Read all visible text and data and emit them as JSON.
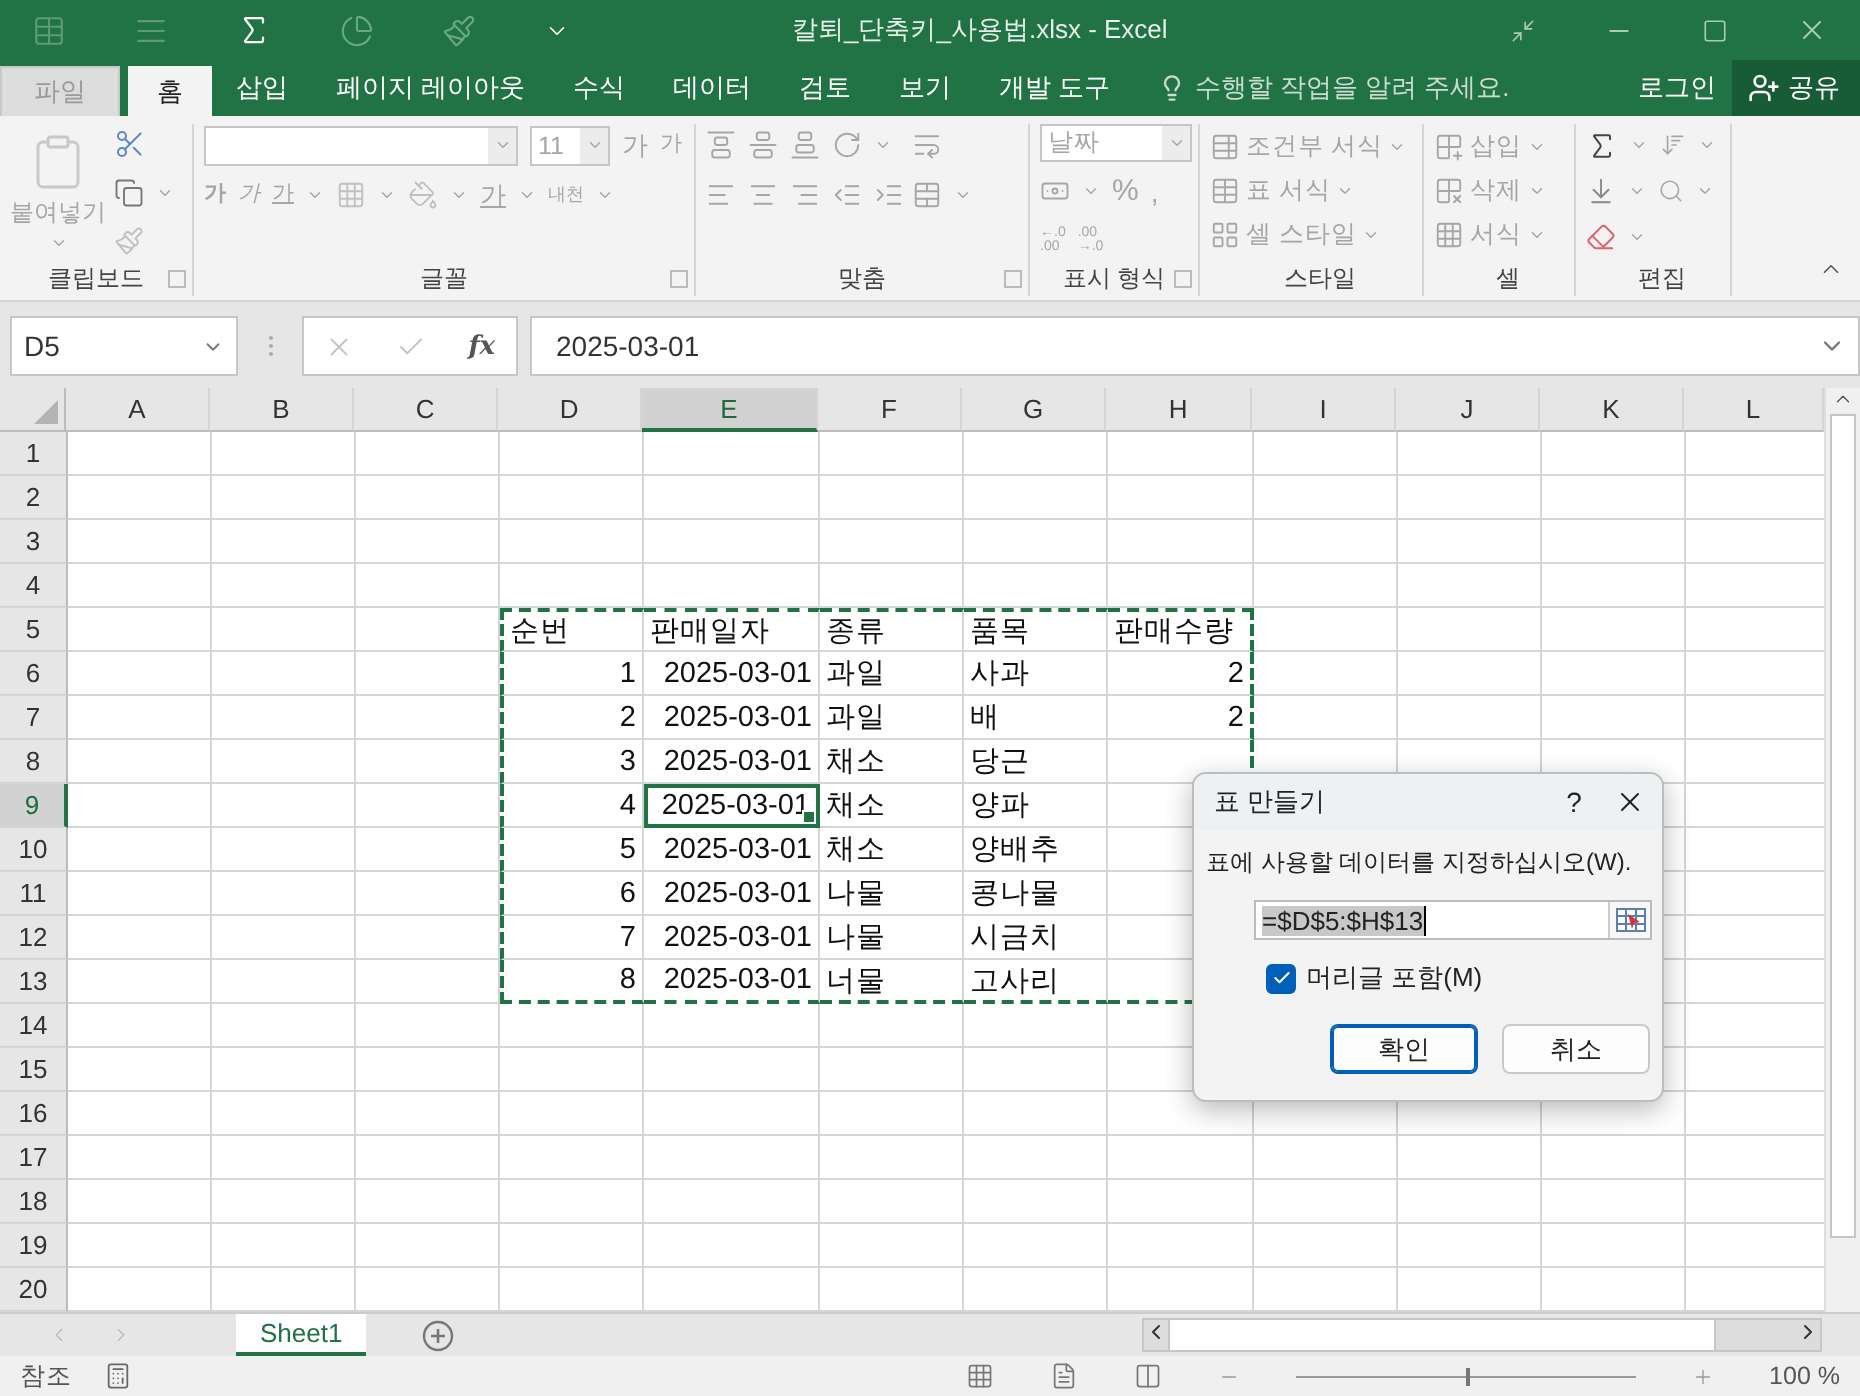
{
  "window": {
    "title": "칼퇴_단축키_사용법.xlsx - Excel"
  },
  "ribbon_tabs": [
    {
      "label": "파일",
      "kind": "file",
      "selected": false
    },
    {
      "label": "홈",
      "kind": "tab",
      "selected": true
    },
    {
      "label": "삽입",
      "kind": "tab",
      "selected": false
    },
    {
      "label": "페이지 레이아웃",
      "kind": "tab",
      "selected": false
    },
    {
      "label": "수식",
      "kind": "tab",
      "selected": false
    },
    {
      "label": "데이터",
      "kind": "tab",
      "selected": false
    },
    {
      "label": "검토",
      "kind": "tab",
      "selected": false
    },
    {
      "label": "보기",
      "kind": "tab",
      "selected": false
    },
    {
      "label": "개발 도구",
      "kind": "tab",
      "selected": false
    }
  ],
  "tell_me": {
    "placeholder": "수행할 작업을 알려 주세요."
  },
  "account": {
    "sign_in": "로그인",
    "share": "공유"
  },
  "ribbon": {
    "clipboard": {
      "label": "클립보드",
      "paste": "붙여넣기"
    },
    "font": {
      "label": "글꼴",
      "size": "11",
      "grow": "가",
      "shrink": "가",
      "bold": "가",
      "italic": "가",
      "underline": "가",
      "font_color": "가",
      "phonetic": "내천"
    },
    "alignment": {
      "label": "맞춤"
    },
    "number": {
      "label": "표시 형식",
      "format": "날짜",
      "percent": "%",
      "comma": ",",
      "decimals": [
        "←.0\n.00",
        ".00\n→.0"
      ]
    },
    "styles": {
      "label": "스타일",
      "items": [
        "조건부 서식",
        "표 서식",
        "셀 스타일"
      ]
    },
    "cells": {
      "label": "셀",
      "items": [
        "삽입",
        "삭제",
        "서식"
      ]
    },
    "editing": {
      "label": "편집"
    }
  },
  "formula_bar": {
    "name_box": "D5",
    "function_label": "fx",
    "value": "2025-03-01"
  },
  "sheet": {
    "columns": [
      {
        "label": "A",
        "selected": false
      },
      {
        "label": "B",
        "selected": false
      },
      {
        "label": "C",
        "selected": false
      },
      {
        "label": "D",
        "selected": false
      },
      {
        "label": "E",
        "selected": true
      },
      {
        "label": "F",
        "selected": false
      },
      {
        "label": "G",
        "selected": false
      },
      {
        "label": "H",
        "selected": false
      },
      {
        "label": "I",
        "selected": false
      },
      {
        "label": "J",
        "selected": false
      },
      {
        "label": "K",
        "selected": false
      },
      {
        "label": "L",
        "selected": false
      }
    ],
    "rows": [
      {
        "label": "1",
        "selected": false,
        "marquee": false
      },
      {
        "label": "2",
        "selected": false,
        "marquee": false
      },
      {
        "label": "3",
        "selected": false,
        "marquee": false
      },
      {
        "label": "4",
        "selected": false,
        "marquee": false
      },
      {
        "label": "5",
        "selected": false,
        "marquee": true,
        "cells": {
          "D": {
            "value": "순번",
            "kind": "text",
            "active": false
          },
          "E": {
            "value": "판매일자",
            "kind": "text",
            "active": false
          },
          "F": {
            "value": "종류",
            "kind": "text",
            "active": false
          },
          "G": {
            "value": "품목",
            "kind": "text",
            "active": false
          },
          "H": {
            "value": "판매수량",
            "kind": "text",
            "active": false
          }
        }
      },
      {
        "label": "6",
        "selected": false,
        "marquee": true,
        "cells": {
          "D": {
            "value": "1",
            "kind": "number",
            "active": false
          },
          "E": {
            "value": "2025-03-01",
            "kind": "number",
            "active": false
          },
          "F": {
            "value": "과일",
            "kind": "text",
            "active": false
          },
          "G": {
            "value": "사과",
            "kind": "text",
            "active": false
          },
          "H": {
            "value": "2",
            "kind": "number",
            "active": false
          }
        }
      },
      {
        "label": "7",
        "selected": false,
        "marquee": true,
        "cells": {
          "D": {
            "value": "2",
            "kind": "number",
            "active": false
          },
          "E": {
            "value": "2025-03-01",
            "kind": "number",
            "active": false
          },
          "F": {
            "value": "과일",
            "kind": "text",
            "active": false
          },
          "G": {
            "value": "배",
            "kind": "text",
            "active": false
          },
          "H": {
            "value": "2",
            "kind": "number",
            "active": false
          }
        }
      },
      {
        "label": "8",
        "selected": false,
        "marquee": true,
        "cells": {
          "D": {
            "value": "3",
            "kind": "number",
            "active": false
          },
          "E": {
            "value": "2025-03-01",
            "kind": "number",
            "active": false
          },
          "F": {
            "value": "채소",
            "kind": "text",
            "active": false
          },
          "G": {
            "value": "당근",
            "kind": "text",
            "active": false
          }
        }
      },
      {
        "label": "9",
        "selected": true,
        "marquee": true,
        "cells": {
          "D": {
            "value": "4",
            "kind": "number",
            "active": false
          },
          "E": {
            "value": "2025-03-01",
            "kind": "number",
            "active": true
          },
          "F": {
            "value": "채소",
            "kind": "text",
            "active": false
          },
          "G": {
            "value": "양파",
            "kind": "text",
            "active": false
          }
        }
      },
      {
        "label": "10",
        "selected": false,
        "marquee": true,
        "cells": {
          "D": {
            "value": "5",
            "kind": "number",
            "active": false
          },
          "E": {
            "value": "2025-03-01",
            "kind": "number",
            "active": false
          },
          "F": {
            "value": "채소",
            "kind": "text",
            "active": false
          },
          "G": {
            "value": "양배추",
            "kind": "text",
            "active": false
          }
        }
      },
      {
        "label": "11",
        "selected": false,
        "marquee": true,
        "cells": {
          "D": {
            "value": "6",
            "kind": "number",
            "active": false
          },
          "E": {
            "value": "2025-03-01",
            "kind": "number",
            "active": false
          },
          "F": {
            "value": "나물",
            "kind": "text",
            "active": false
          },
          "G": {
            "value": "콩나물",
            "kind": "text",
            "active": false
          }
        }
      },
      {
        "label": "12",
        "selected": false,
        "marquee": true,
        "cells": {
          "D": {
            "value": "7",
            "kind": "number",
            "active": false
          },
          "E": {
            "value": "2025-03-01",
            "kind": "number",
            "active": false
          },
          "F": {
            "value": "나물",
            "kind": "text",
            "active": false
          },
          "G": {
            "value": "시금치",
            "kind": "text",
            "active": false
          }
        }
      },
      {
        "label": "13",
        "selected": false,
        "marquee": true,
        "cells": {
          "D": {
            "value": "8",
            "kind": "number",
            "active": false
          },
          "E": {
            "value": "2025-03-01",
            "kind": "number",
            "active": false
          },
          "F": {
            "value": "너물",
            "kind": "text",
            "active": false
          },
          "G": {
            "value": "고사리",
            "kind": "text",
            "active": false
          }
        }
      },
      {
        "label": "14",
        "selected": false,
        "marquee": false
      },
      {
        "label": "15",
        "selected": false,
        "marquee": false
      },
      {
        "label": "16",
        "selected": false,
        "marquee": false
      },
      {
        "label": "17",
        "selected": false,
        "marquee": false
      },
      {
        "label": "18",
        "selected": false,
        "marquee": false
      },
      {
        "label": "19",
        "selected": false,
        "marquee": false
      },
      {
        "label": "20",
        "selected": false,
        "marquee": false
      }
    ]
  },
  "sheet_tabs": [
    {
      "label": "Sheet1",
      "selected": true
    }
  ],
  "status_bar": {
    "mode": "참조",
    "zoom": "100 %",
    "zoom_slider": {
      "level": 0.5
    }
  },
  "dialog": {
    "title": "표 만들기",
    "help": "?",
    "prompt": "표에 사용할 데이터를 지정하십시오(W).",
    "range": "=$D$5:$H$13",
    "header_checkbox": {
      "label": "머리글 포함(M)",
      "checked": true
    },
    "buttons": [
      {
        "label": "확인",
        "kind": "default"
      },
      {
        "label": "취소",
        "kind": "normal"
      }
    ]
  }
}
